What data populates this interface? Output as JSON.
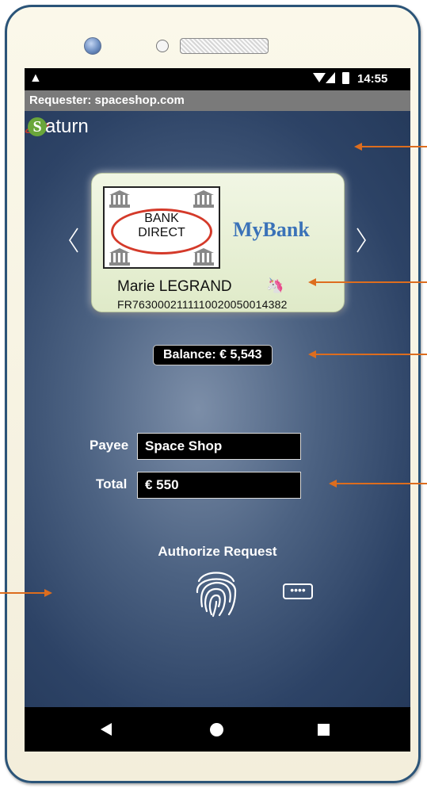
{
  "status_bar": {
    "warning_icon": "warning-triangle-icon",
    "time": "14:55"
  },
  "requester": "Requester: spaceshop.com",
  "app": {
    "logo_letter": "S",
    "logo_text": "aturn"
  },
  "card": {
    "bank_logo_text_line1": "BANK",
    "bank_logo_text_line2": "DIRECT",
    "bank_brand": "MyBank",
    "holder_name": "Marie LEGRAND",
    "holder_icon": "🦄",
    "iban": "FR7630002111110020050014382"
  },
  "balance": "Balance: € 5,543",
  "form": {
    "payee_label": "Payee",
    "payee_value": "Space Shop",
    "total_label": "Total",
    "total_value": "€ 550"
  },
  "authorize_label": "Authorize Request",
  "pin_button_label": "••••",
  "colors": {
    "callout": "#dd6d1e",
    "phone_border": "#2b5478",
    "brand": "#3a72b8"
  }
}
